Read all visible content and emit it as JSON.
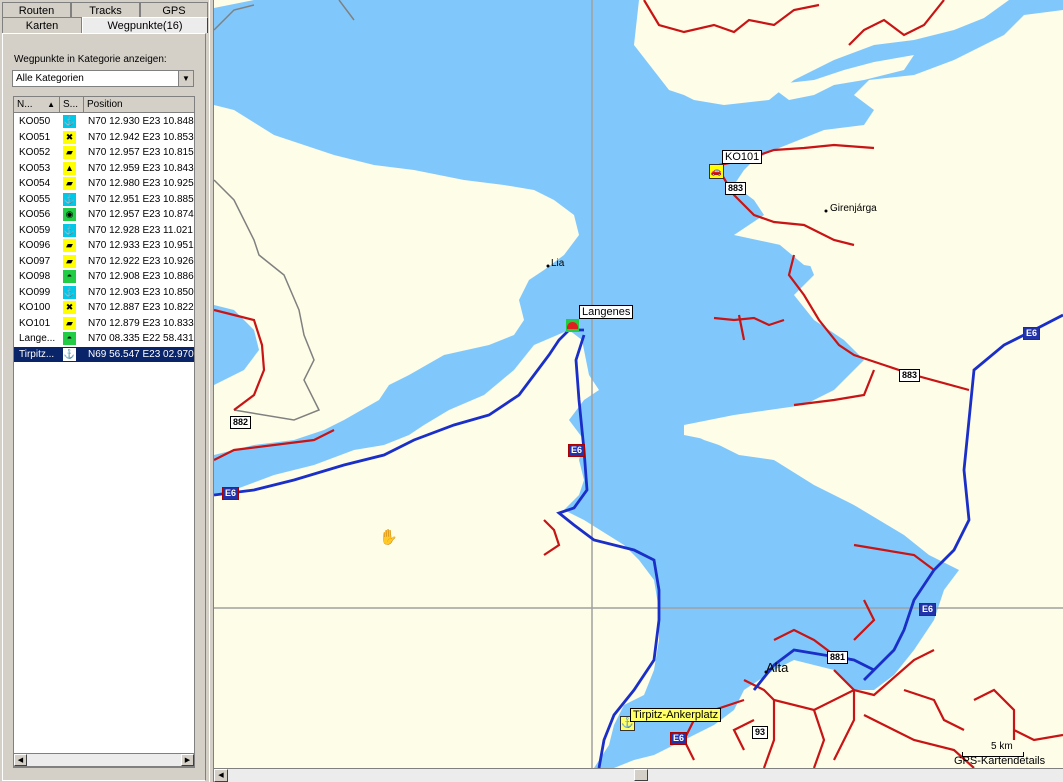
{
  "tabs_row1": [
    {
      "label": "Routen",
      "name": "tab-routen"
    },
    {
      "label": "Tracks",
      "name": "tab-tracks"
    },
    {
      "label": "GPS",
      "name": "tab-gps"
    }
  ],
  "tabs_row2": [
    {
      "label": "Karten",
      "name": "tab-karten"
    },
    {
      "label": "Wegpunkte(16)",
      "name": "tab-wegpunkte",
      "active": true
    }
  ],
  "category": {
    "label": "Wegpunkte in Kategorie anzeigen:",
    "selected": "Alle Kategorien"
  },
  "list": {
    "headers": {
      "name": "N...",
      "symbol": "S...",
      "position": "Position"
    },
    "rows": [
      {
        "name": "KO050",
        "icon": "anchor-down-icon",
        "bg": "#00c8e8",
        "position": "N70 12.930 E23 10.848"
      },
      {
        "name": "KO051",
        "icon": "shipwreck-icon",
        "bg": "#ffff00",
        "position": "N70 12.942 E23 10.853"
      },
      {
        "name": "KO052",
        "icon": "car-icon",
        "bg": "#ffff00",
        "position": "N70 12.957 E23 10.815"
      },
      {
        "name": "KO053",
        "icon": "triangle-icon",
        "bg": "#ffff00",
        "position": "N70 12.959 E23 10.843"
      },
      {
        "name": "KO054",
        "icon": "car-icon",
        "bg": "#ffff00",
        "position": "N70 12.980 E23 10.925"
      },
      {
        "name": "KO055",
        "icon": "anchor-down-icon",
        "bg": "#00c8e8",
        "position": "N70 12.951 E23 10.885"
      },
      {
        "name": "KO056",
        "icon": "circle-target-icon",
        "bg": "#22cc44",
        "position": "N70 12.957 E23 10.874"
      },
      {
        "name": "KO059",
        "icon": "anchor-down-icon",
        "bg": "#00c8e8",
        "position": "N70 12.928 E23 11.021"
      },
      {
        "name": "KO096",
        "icon": "car-icon",
        "bg": "#ffff00",
        "position": "N70 12.933 E23 10.951"
      },
      {
        "name": "KO097",
        "icon": "car-icon",
        "bg": "#ffff00",
        "position": "N70 12.922 E23 10.926"
      },
      {
        "name": "KO098",
        "icon": "half-circle-icon",
        "bg": "#22cc44",
        "position": "N70 12.908 E23 10.886"
      },
      {
        "name": "KO099",
        "icon": "anchor-down-icon",
        "bg": "#00c8e8",
        "position": "N70 12.903 E23 10.850"
      },
      {
        "name": "KO100",
        "icon": "shipwreck-icon",
        "bg": "#ffff00",
        "position": "N70 12.887 E23 10.822"
      },
      {
        "name": "KO101",
        "icon": "car-icon",
        "bg": "#ffff00",
        "position": "N70 12.879 E23 10.833"
      },
      {
        "name": "Lange...",
        "icon": "half-circle-icon",
        "bg": "#22cc44",
        "position": "N70 08.335 E22 58.431"
      },
      {
        "name": "Tirpitz...",
        "icon": "anchor-icon",
        "bg": "#ffffff",
        "position": "N69 56.547 E23 02.970",
        "selected": true
      }
    ]
  },
  "map": {
    "colors": {
      "water": "#80c8fc",
      "land": "#fefde8",
      "road_main": "#1a2ec8",
      "road_minor": "#c81414",
      "border": "#808080"
    },
    "place_labels": {
      "lia": "Lia",
      "girenjarga": "Girenjárga",
      "alta": "Alta"
    },
    "waypoints": {
      "ko101": "KO101",
      "langenes": "Langenes",
      "tirpitz": "Tirpitz-Ankerplatz"
    },
    "shields": {
      "e6_1": "E6",
      "e6_2": "E6",
      "e6_3": "E6",
      "e6_4": "E6",
      "e6_5": "E6",
      "r883_1": "883",
      "r883_2": "883",
      "r882": "882",
      "r881": "881",
      "r93": "93"
    },
    "scale": "5 km",
    "details_label": "GPS-Kartendetails"
  }
}
